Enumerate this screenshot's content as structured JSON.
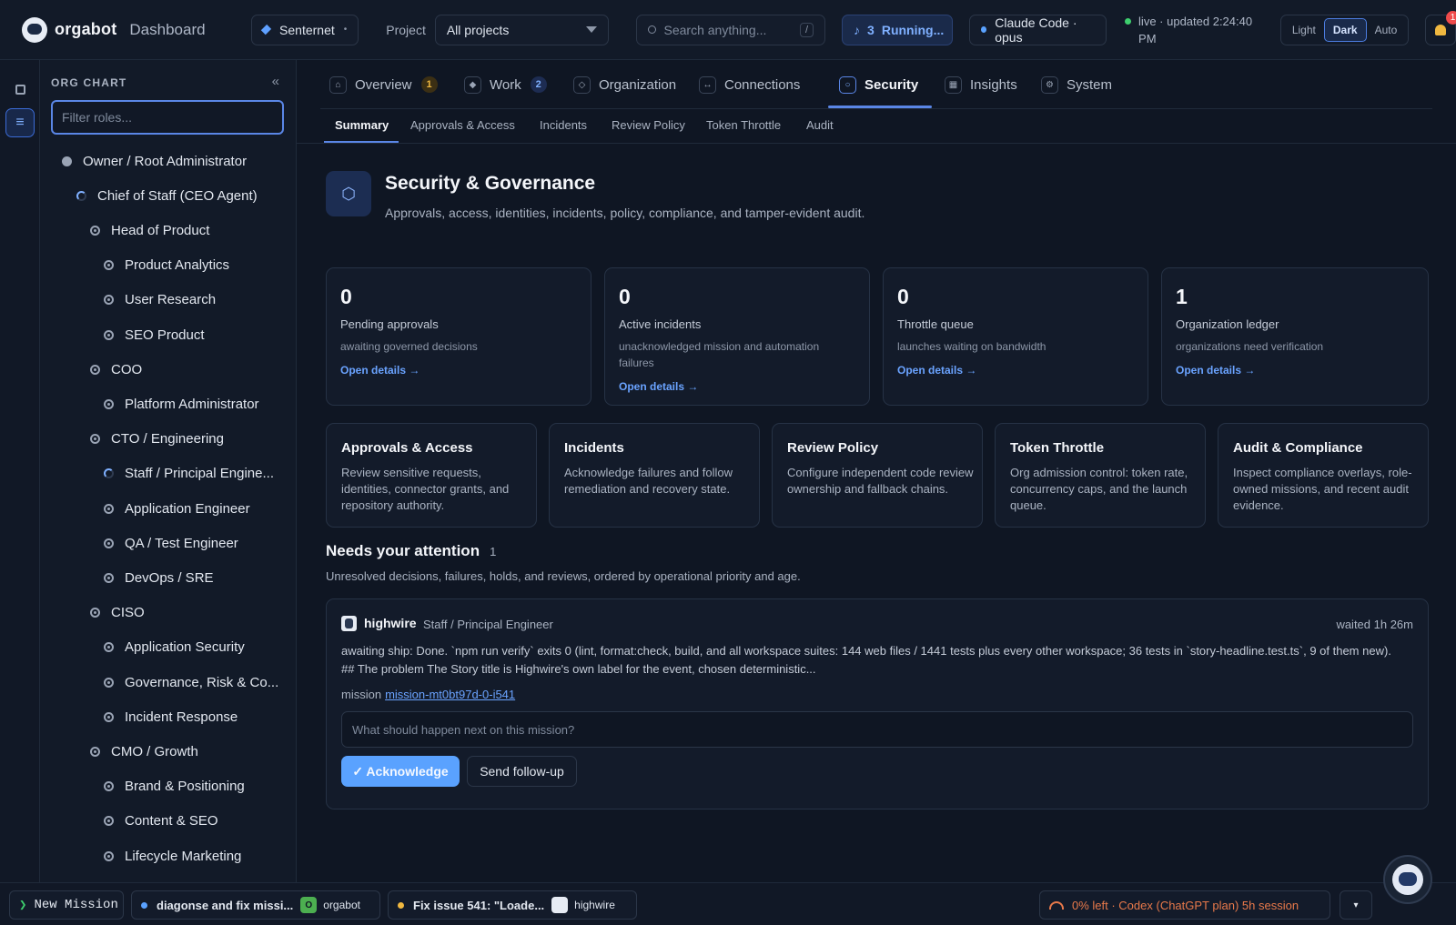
{
  "topbar": {
    "brand": "orgabot",
    "section": "Dashboard",
    "workspace": "Senternet",
    "project_label": "Project",
    "project_value": "All projects",
    "search_placeholder": "Search anything...",
    "search_shortcut": "/",
    "running_count": "3",
    "running_label": "Running...",
    "model": "Claude Code · opus",
    "live_status": "live · updated 2:24:40 PM",
    "theme_options": [
      "Light",
      "Dark",
      "Auto"
    ],
    "theme_selected": "Dark",
    "notifications_count": "1"
  },
  "org_chart": {
    "title": "ORG CHART",
    "collapse_glyph": "«",
    "filter_placeholder": "Filter roles...",
    "roles": [
      {
        "label": "Owner / Root Administrator",
        "depth": 0,
        "status": "solid"
      },
      {
        "label": "Chief of Staff (CEO Agent)",
        "depth": 1,
        "status": "working"
      },
      {
        "label": "Head of Product",
        "depth": 2,
        "status": "ring"
      },
      {
        "label": "Product Analytics",
        "depth": 3,
        "status": "ring"
      },
      {
        "label": "User Research",
        "depth": 3,
        "status": "ring"
      },
      {
        "label": "SEO Product",
        "depth": 3,
        "status": "ring"
      },
      {
        "label": "COO",
        "depth": 2,
        "status": "ring"
      },
      {
        "label": "Platform Administrator",
        "depth": 3,
        "status": "ring"
      },
      {
        "label": "CTO / Engineering",
        "depth": 2,
        "status": "ring"
      },
      {
        "label": "Staff / Principal Engine...",
        "depth": 3,
        "status": "working"
      },
      {
        "label": "Application Engineer",
        "depth": 3,
        "status": "ring"
      },
      {
        "label": "QA / Test Engineer",
        "depth": 3,
        "status": "ring"
      },
      {
        "label": "DevOps / SRE",
        "depth": 3,
        "status": "ring"
      },
      {
        "label": "CISO",
        "depth": 2,
        "status": "ring"
      },
      {
        "label": "Application Security",
        "depth": 3,
        "status": "ring"
      },
      {
        "label": "Governance, Risk & Co...",
        "depth": 3,
        "status": "ring"
      },
      {
        "label": "Incident Response",
        "depth": 3,
        "status": "ring"
      },
      {
        "label": "CMO / Growth",
        "depth": 2,
        "status": "ring"
      },
      {
        "label": "Brand & Positioning",
        "depth": 3,
        "status": "ring"
      },
      {
        "label": "Content & SEO",
        "depth": 3,
        "status": "ring"
      },
      {
        "label": "Lifecycle Marketing",
        "depth": 3,
        "status": "ring"
      }
    ]
  },
  "tabs": [
    {
      "label": "Overview",
      "icon": "home-icon",
      "badge": "1",
      "badge_color": "#f0b840"
    },
    {
      "label": "Work",
      "icon": "diamond-icon",
      "badge": "2",
      "badge_color": "#7fb0ff"
    },
    {
      "label": "Organization",
      "icon": "org-icon",
      "badge": ""
    },
    {
      "label": "Connections",
      "icon": "arrows-icon",
      "badge": ""
    },
    {
      "label": "Security",
      "icon": "shield-icon",
      "badge": "",
      "active": true
    },
    {
      "label": "Insights",
      "icon": "chart-icon",
      "badge": ""
    },
    {
      "label": "System",
      "icon": "gear-icon",
      "badge": ""
    }
  ],
  "subtabs": [
    "Summary",
    "Approvals & Access",
    "Incidents",
    "Review Policy",
    "Token Throttle",
    "Audit"
  ],
  "subtab_active": "Summary",
  "hero": {
    "title": "Security & Governance",
    "subtitle": "Approvals, access, identities, incidents, policy, compliance, and tamper-evident audit."
  },
  "stats": [
    {
      "value": "0",
      "label": "Pending approvals",
      "desc": "awaiting governed decisions",
      "link": "Open details →"
    },
    {
      "value": "0",
      "label": "Active incidents",
      "desc": "unacknowledged mission and automation failures",
      "link": "Open details →"
    },
    {
      "value": "0",
      "label": "Throttle queue",
      "desc": "launches waiting on bandwidth",
      "link": "Open details →"
    },
    {
      "value": "1",
      "label": "Organization ledger",
      "desc": "organizations need verification",
      "link": "Open details →"
    }
  ],
  "features": [
    {
      "title": "Approvals & Access",
      "desc": "Review sensitive requests, identities, connector grants, and repository authority."
    },
    {
      "title": "Incidents",
      "desc": "Acknowledge failures and follow remediation and recovery state."
    },
    {
      "title": "Review Policy",
      "desc": "Configure independent code review ownership and fallback chains."
    },
    {
      "title": "Token Throttle",
      "desc": "Org admission control: token rate, concurrency caps, and the launch queue."
    },
    {
      "title": "Audit & Compliance",
      "desc": "Inspect compliance overlays, role-owned missions, and recent audit evidence."
    }
  ],
  "attention": {
    "title": "Needs your attention",
    "count": "1",
    "subtitle": "Unresolved decisions, failures, holds, and reviews, ordered by operational priority and age.",
    "item": {
      "agent": "highwire",
      "role": "Staff / Principal Engineer",
      "waited": "waited 1h 26m",
      "body": "awaiting ship: Done. `npm run verify` exits 0 (lint, format:check, build, and all workspace suites: 144 web files / 1441 tests plus every other workspace; 36 tests in `story-headline.test.ts`, 9 of them new). ## The problem The Story title is Highwire's own label for the event, chosen deterministic...",
      "mission_label": "mission",
      "mission_id": "mission-mt0bt97d-0-i541",
      "input_placeholder": "What should happen next on this mission?",
      "ack_label": "✓ Acknowledge",
      "followup_label": "Send follow-up"
    }
  },
  "bottombar": {
    "new_mission": "New Mission",
    "missions": [
      {
        "title": "diagonse and fix missi...",
        "dot_color": "#5aa2ff",
        "tag": "O",
        "tag_color": "#4caf50",
        "owner": "orgabot"
      },
      {
        "title": "Fix issue 541: \"Loade...",
        "dot_color": "#f0b840",
        "tag": "",
        "owner": "highwire"
      }
    ],
    "quota": "0% left · Codex (ChatGPT plan) 5h session",
    "more_glyph": "▾"
  }
}
